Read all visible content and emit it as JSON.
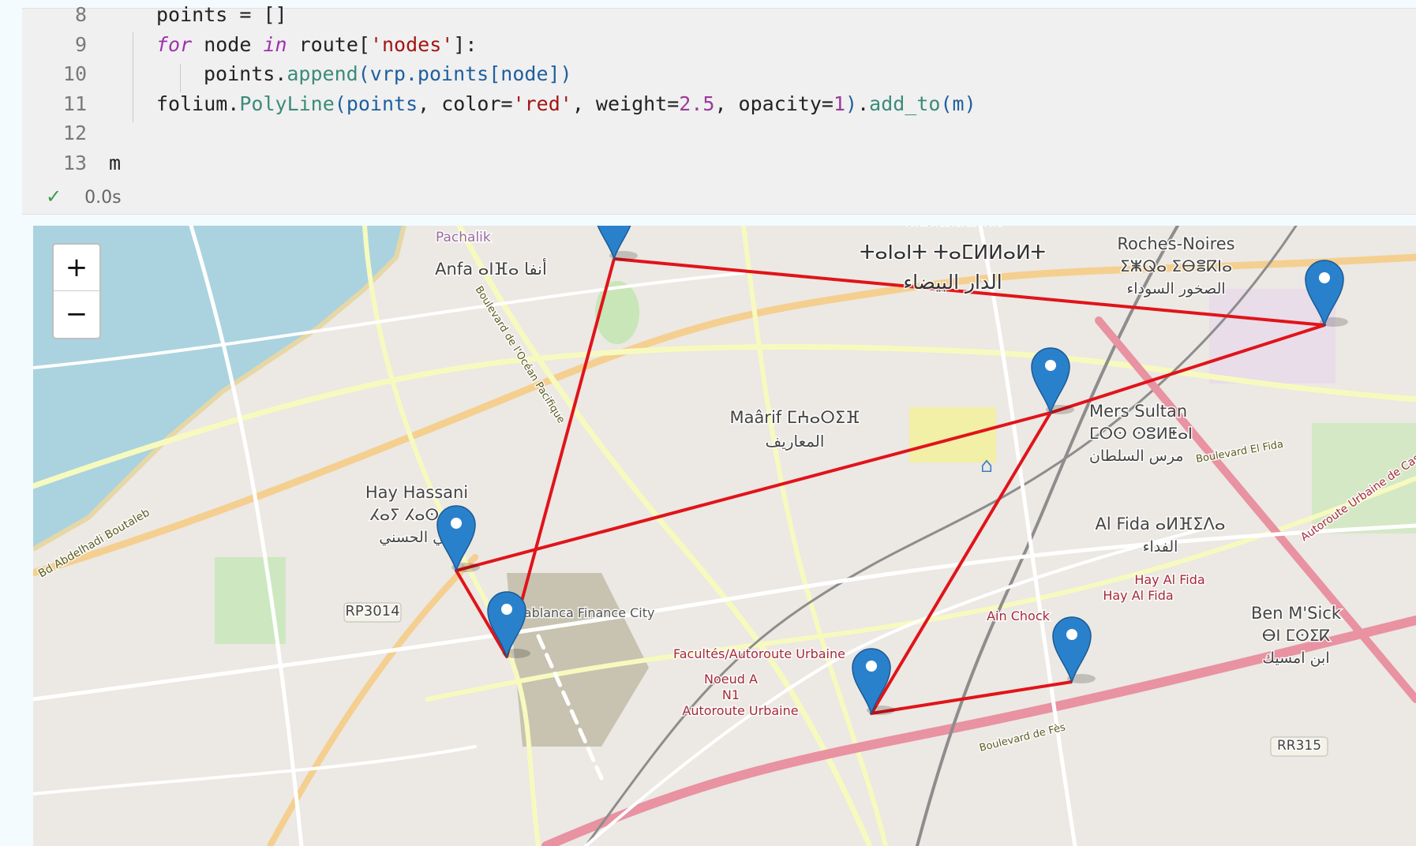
{
  "code": {
    "lines": [
      {
        "n": "8",
        "parts": [
          [
            "c",
            "points = []"
          ]
        ]
      },
      {
        "n": "9",
        "parts": [
          [
            "kw",
            "for"
          ],
          [
            "c",
            " node "
          ],
          [
            "kw",
            "in"
          ],
          [
            "c",
            " route["
          ],
          [
            "str",
            "'nodes'"
          ],
          [
            "c",
            "]:"
          ]
        ]
      },
      {
        "n": "10",
        "parts": [
          [
            "c",
            "points."
          ],
          [
            "fn",
            "append"
          ],
          [
            "var",
            "(vrp.points[node])"
          ]
        ]
      },
      {
        "n": "11",
        "parts": [
          [
            "c",
            "folium."
          ],
          [
            "fn",
            "PolyLine"
          ],
          [
            "var",
            "(points"
          ],
          [
            "c",
            ", color="
          ],
          [
            "str",
            "'red'"
          ],
          [
            "c",
            ", weight="
          ],
          [
            "num",
            "2.5"
          ],
          [
            "c",
            ", opacity="
          ],
          [
            "num",
            "1"
          ],
          [
            "var",
            ")"
          ],
          [
            "c",
            "."
          ],
          [
            "fn",
            "add_to"
          ],
          [
            "var",
            "(m)"
          ]
        ]
      },
      {
        "n": "12",
        "parts": []
      },
      {
        "n": "13",
        "parts": [
          [
            "c",
            "m"
          ]
        ]
      }
    ]
  },
  "status": {
    "check": "✓",
    "time": "0.0s"
  },
  "map": {
    "zoom_in": "+",
    "zoom_out": "−",
    "route_color": "#e0141a",
    "marker_color": "#2a81cb",
    "labels": [
      {
        "id": "casablanca-latin",
        "text": "Casablanca"
      },
      {
        "id": "casablanca-tifinagh",
        "text": "ⵜⴰⵏⴰⵏⵜ ⵜⴰⵎⵍⵍⴰⵍⵜ"
      },
      {
        "id": "casablanca-arabic",
        "text": "الدار البيضاء"
      },
      {
        "id": "roches-noires",
        "text": "Roches-Noires"
      },
      {
        "id": "roches-noires-tifinagh",
        "text": "ⵉⵥⵕⴰ ⵉⴱⴻⴽⵏⴰ"
      },
      {
        "id": "roches-noires-arabic",
        "text": "الصخور السوداء"
      },
      {
        "id": "anfa",
        "text": "Anfa ⴰⵏⴼⴰ أنفا"
      },
      {
        "id": "pachalik",
        "text": "Pachalik"
      },
      {
        "id": "boulevard-ocean",
        "text": "Boulevard de l'Océan Pacifique"
      },
      {
        "id": "maarif",
        "text": "Maârif ⵎⵄⴰⵔⵉⴼ"
      },
      {
        "id": "maarif-arabic",
        "text": "المعاريف"
      },
      {
        "id": "mers-sultan",
        "text": "Mers Sultan"
      },
      {
        "id": "mers-sultan-tifinagh",
        "text": "ⵎⵔⵙ ⵙⵓⵍⵟⴰⵏ"
      },
      {
        "id": "mers-sultan-arabic",
        "text": "مرس السلطان"
      },
      {
        "id": "bd-el-fida",
        "text": "Boulevard El Fida"
      },
      {
        "id": "hay-hassani",
        "text": "Hay Hassani"
      },
      {
        "id": "hay-hassani-tifinagh",
        "text": "ⵃⴰⵢ ⵃⴰⵙⴰⵏⵉ"
      },
      {
        "id": "hay-hassani-arabic",
        "text": "حي الحسني"
      },
      {
        "id": "al-fida",
        "text": "Al Fida ⴰⵍⴼⵉⴷⴰ"
      },
      {
        "id": "al-fida-arabic",
        "text": "الفداء"
      },
      {
        "id": "bd-boutaleb",
        "text": "Bd Abdelhadi Boutaleb"
      },
      {
        "id": "autoroute-urbaine-east",
        "text": "Autoroute Urbaine de Casablanca"
      },
      {
        "id": "hay-al-fida-1",
        "text": "Hay Al Fida"
      },
      {
        "id": "hay-al-fida-2",
        "text": "Hay Al Fida"
      },
      {
        "id": "ain-chock",
        "text": "Ain Chock"
      },
      {
        "id": "ben-msick",
        "text": "Ben M'Sick"
      },
      {
        "id": "ben-msick-tifinagh",
        "text": "ⴱⵏ ⵎⵙⵉⴽ"
      },
      {
        "id": "ben-msick-arabic",
        "text": "ابن امسيك"
      },
      {
        "id": "rp3014",
        "text": "RP3014"
      },
      {
        "id": "casablanca-finance-city",
        "text": "Casablanca Finance City"
      },
      {
        "id": "facultes",
        "text": "Facultés/Autoroute Urbaine"
      },
      {
        "id": "noeud-a",
        "text": "Noeud A"
      },
      {
        "id": "n1",
        "text": "N1"
      },
      {
        "id": "autoroute-urbaine-sw",
        "text": "Autoroute Urbaine"
      },
      {
        "id": "rr315",
        "text": "RR315"
      },
      {
        "id": "bd-de-fes",
        "text": "Boulevard de Fès"
      }
    ]
  }
}
